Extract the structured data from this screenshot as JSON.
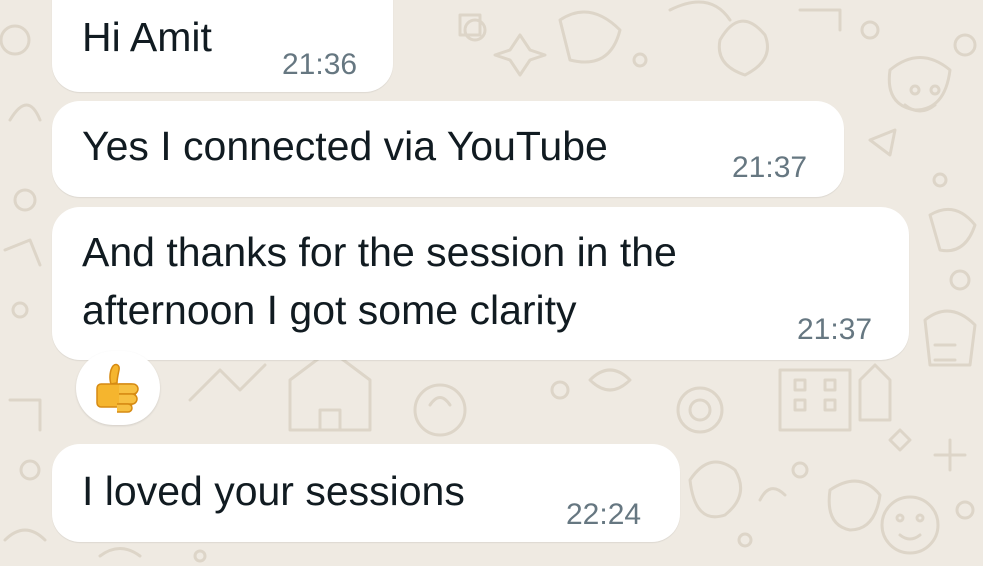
{
  "chat": {
    "messages": [
      {
        "lines": [
          "Hi Amit"
        ],
        "time": "21:36"
      },
      {
        "lines": [
          "Yes I connected via YouTube"
        ],
        "time": "21:37"
      },
      {
        "lines": [
          "And thanks for the session in the",
          "afternoon I got some clarity"
        ],
        "time": "21:37",
        "reaction": "thumbs-up-icon"
      },
      {
        "lines": [
          "I loved your sessions"
        ],
        "time": "22:24"
      }
    ]
  },
  "colors": {
    "wallpaper": "#efeae2",
    "doodle": "#ddd5c8",
    "bubble": "#ffffff",
    "time_text": "#667781",
    "thumb": "#f5b52e"
  }
}
